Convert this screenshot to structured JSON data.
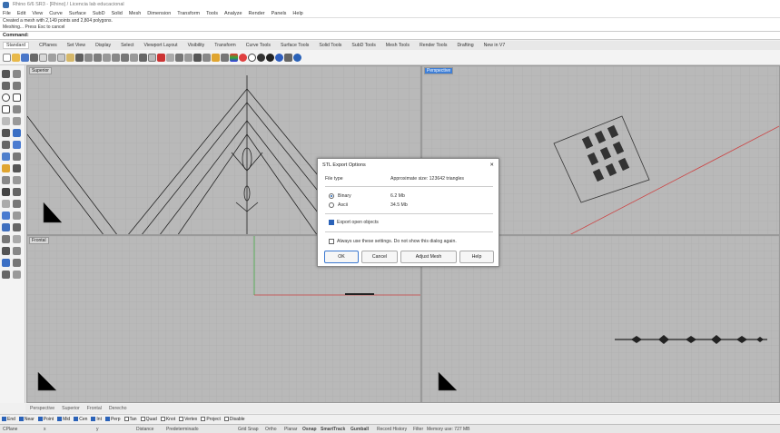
{
  "window": {
    "title": "Rhino 6/6 SR3 - [Rhino] / Licencia lab educacional"
  },
  "menu": [
    "File",
    "Edit",
    "View",
    "Curve",
    "Surface",
    "SubD",
    "Solid",
    "Mesh",
    "Dimension",
    "Transform",
    "Tools",
    "Analyze",
    "Render",
    "Panels",
    "Help"
  ],
  "command_history": [
    "Created a mesh with 2,149 points and 2,804 polygons.",
    "Meshing... Press Esc to cancel"
  ],
  "command_prompt": "Command:",
  "toolbar_tabs": [
    "Standard",
    "CPlanes",
    "Set View",
    "Display",
    "Select",
    "Viewport Layout",
    "Visibility",
    "Transform",
    "Curve Tools",
    "Surface Tools",
    "Solid Tools",
    "SubD Tools",
    "Mesh Tools",
    "Render Tools",
    "Drafting",
    "New in V7"
  ],
  "viewports": {
    "top": "Superior",
    "perspective": "Perspective",
    "front": "Frontal"
  },
  "dialog": {
    "title": "STL Export Options",
    "close": "✕",
    "file_type_label": "File type",
    "approx_label": "Approximate size: 123642 triangles",
    "binary_label": "Binary",
    "binary_size": "6.2 Mb",
    "ascii_label": "Ascii",
    "ascii_size": "34.5 Mb",
    "export_open_label": "Export open objects",
    "always_use_label": "Always use these settings. Do not show this dialog again.",
    "ok": "OK",
    "cancel": "Cancel",
    "adjust_mesh": "Adjust Mesh",
    "help": "Help"
  },
  "viewport_tabs": [
    "Perspective",
    "Superior",
    "Frontal",
    "Derecho"
  ],
  "osnaps": [
    {
      "label": "End",
      "on": true
    },
    {
      "label": "Near",
      "on": true
    },
    {
      "label": "Point",
      "on": true
    },
    {
      "label": "Mid",
      "on": true
    },
    {
      "label": "Cen",
      "on": true
    },
    {
      "label": "Int",
      "on": true
    },
    {
      "label": "Perp",
      "on": true
    },
    {
      "label": "Tan",
      "on": false
    },
    {
      "label": "Quad",
      "on": false
    },
    {
      "label": "Knot",
      "on": false
    },
    {
      "label": "Vertex",
      "on": false
    },
    {
      "label": "Project",
      "on": false
    },
    {
      "label": "Disable",
      "on": false
    }
  ],
  "status": {
    "cplane": "CPlane",
    "x": "x",
    "y": "y",
    "distance": "Distance",
    "layer": "Predeterminado",
    "grid_snap": "Grid Snap",
    "ortho": "Ortho",
    "planar": "Planar",
    "osnap": "Osnap",
    "smarttrack": "SmartTrack",
    "gumball": "Gumball",
    "record_history": "Record History",
    "filter": "Filter",
    "memory": "Memory use: 727 MB"
  },
  "colors": {
    "viewport_bg": "#b9b9b9",
    "grid": "#a8a8a8",
    "active_label": "#3f7fd6",
    "accent": "#2a62b8"
  }
}
